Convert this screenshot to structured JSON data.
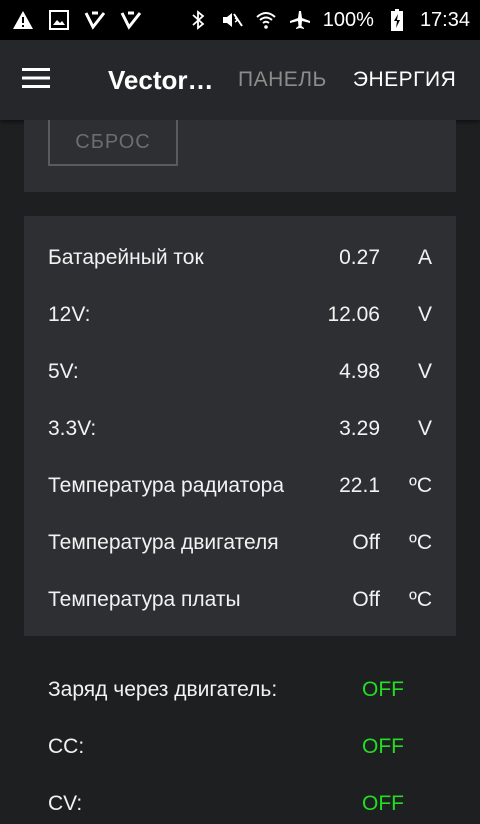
{
  "status_bar": {
    "battery_percent": "100%",
    "time": "17:34"
  },
  "app_bar": {
    "title": "Vector…",
    "tabs": [
      {
        "label": "ПАНЕЛЬ",
        "active": false
      },
      {
        "label": "ЭНЕРГИЯ",
        "active": true
      }
    ]
  },
  "reset_button": {
    "label": "СБРОС"
  },
  "readings": [
    {
      "label": "Батарейный ток",
      "value": "0.27",
      "unit": "A"
    },
    {
      "label": "12V:",
      "value": "12.06",
      "unit": "V"
    },
    {
      "label": "5V:",
      "value": "4.98",
      "unit": "V"
    },
    {
      "label": "3.3V:",
      "value": "3.29",
      "unit": "V"
    },
    {
      "label": "Температура радиатора",
      "value": "22.1",
      "unit": "ºC"
    },
    {
      "label": "Температура двигателя",
      "value": "Off",
      "unit": "ºC"
    },
    {
      "label": "Температура платы",
      "value": "Off",
      "unit": "ºC"
    }
  ],
  "modes": [
    {
      "label": "Заряд через двигатель:",
      "state": "OFF"
    },
    {
      "label": "CC:",
      "state": "OFF"
    },
    {
      "label": "CV:",
      "state": "OFF"
    }
  ],
  "colors": {
    "background": "#1e1f21",
    "card": "#2e2f32",
    "state_on_text": "#22dd22",
    "tab_inactive": "#8c8c8c"
  }
}
